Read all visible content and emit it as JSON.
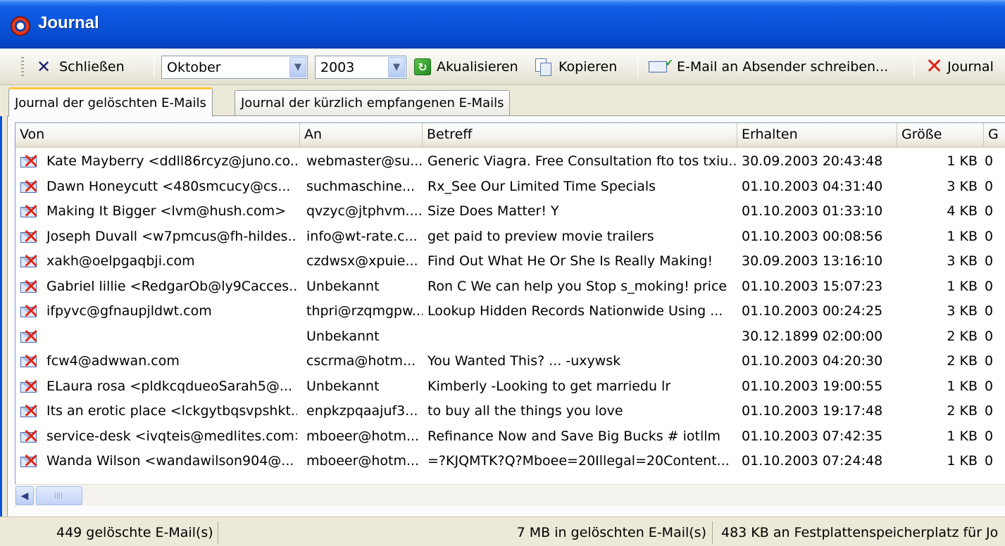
{
  "window": {
    "title": "Journal"
  },
  "toolbar": {
    "close_label": "Schließen",
    "month": "Oktober",
    "year": "2003",
    "refresh_label": "Akualisieren",
    "copy_label": "Kopieren",
    "mail_label": "E-Mail an Absender schreiben...",
    "journal_label": "Journal"
  },
  "tabs": [
    {
      "label": "Journal der gelöschten E-Mails",
      "active": true
    },
    {
      "label": "Journal der kürzlich empfangenen E-Mails",
      "active": false
    }
  ],
  "columns": [
    "Von",
    "An",
    "Betreff",
    "Erhalten",
    "Größe",
    "G"
  ],
  "rows": [
    {
      "from": "Kate Mayberry <ddll86rcyz@juno.co...",
      "to": "webmaster@su...",
      "subject": "Generic Viagra. Free Consultation fto tos txiu...",
      "received": "30.09.2003 20:43:48",
      "size": "1 KB",
      "extra": "0"
    },
    {
      "from": "Dawn Honeycutt <480smcucy@cs...",
      "to": "suchmaschine...",
      "subject": "Rx_See Our Limited Time Specials",
      "received": "01.10.2003 04:31:40",
      "size": "3 KB",
      "extra": "0"
    },
    {
      "from": "Making It Bigger <lvm@hush.com>",
      "to": "qvzyc@jtphvm....",
      "subject": "Size Does Matter!                    Y",
      "received": "01.10.2003 01:33:10",
      "size": "4 KB",
      "extra": "0"
    },
    {
      "from": "Joseph Duvall <w7pmcus@fh-hildes...",
      "to": "info@wt-rate.c...",
      "subject": "get paid to preview movie trailers",
      "received": "01.10.2003 00:08:56",
      "size": "1 KB",
      "extra": "0"
    },
    {
      "from": "xakh@oelpgaqbji.com",
      "to": "czdwsx@xpuie...",
      "subject": "Find Out What He Or She Is Really Making!",
      "received": "30.09.2003 13:16:10",
      "size": "3 KB",
      "extra": "0"
    },
    {
      "from": "Gabriel lillie <RedgarOb@ly9Cacces...",
      "to": "Unbekannt",
      "subject": "Ron C We can help you Stop s_moking! price",
      "received": "01.10.2003 15:07:23",
      "size": "1 KB",
      "extra": "0"
    },
    {
      "from": "ifpyvc@gfnaupjldwt.com",
      "to": "thpri@rzqmgpw...",
      "subject": "Lookup Hidden Records Nationwide Using ...",
      "received": "01.10.2003 00:24:25",
      "size": "3 KB",
      "extra": "0"
    },
    {
      "from": "",
      "to": "Unbekannt",
      "subject": "",
      "received": "30.12.1899 02:00:00",
      "size": "2 KB",
      "extra": "0"
    },
    {
      "from": "fcw4@adwwan.com",
      "to": "cscrma@hotm...",
      "subject": "You Wanted This? ... -uxywsk",
      "received": "01.10.2003 04:20:30",
      "size": "2 KB",
      "extra": "0"
    },
    {
      "from": "ELaura rosa <pldkcqdueoSarah5@...",
      "to": "Unbekannt",
      "subject": "Kimberly -Looking to get marriedu lr",
      "received": "01.10.2003 19:00:55",
      "size": "1 KB",
      "extra": "0"
    },
    {
      "from": "Its an erotic place <lckgytbqsvpshkt...",
      "to": "enpkzpqaajuf3...",
      "subject": "to buy all the things you love",
      "received": "01.10.2003 19:17:48",
      "size": "2 KB",
      "extra": "0"
    },
    {
      "from": "service-desk <ivqteis@medlites.com>",
      "to": "mboeer@hotm...",
      "subject": "Refinance Now and Save Big Bucks # iotllm",
      "received": "01.10.2003 07:42:35",
      "size": "1 KB",
      "extra": "0"
    },
    {
      "from": "Wanda Wilson <wandawilson904@...",
      "to": "mboeer@hotm...",
      "subject": "=?KJQMTK?Q?Mboee=20Illegal=20Content...",
      "received": "01.10.2003 07:24:48",
      "size": "1 KB",
      "extra": "0"
    }
  ],
  "status": {
    "deleted_count": "449 gelöschte E-Mail(s)",
    "deleted_size": "7 MB in gelöschten E-Mail(s)",
    "disk_usage": "483 KB an Festplattenspeicherplatz für Jo"
  },
  "icons": {
    "title": "journal-icon",
    "close": "close-x-icon",
    "refresh": "refresh-icon",
    "copy": "copy-icon",
    "mail": "mail-check-icon",
    "journal": "red-x-icon",
    "row": "deleted-mail-icon"
  },
  "colors": {
    "titlebar": "#0a53d8",
    "tab_accent": "#ffc83c",
    "delete_red": "#e0200e"
  }
}
